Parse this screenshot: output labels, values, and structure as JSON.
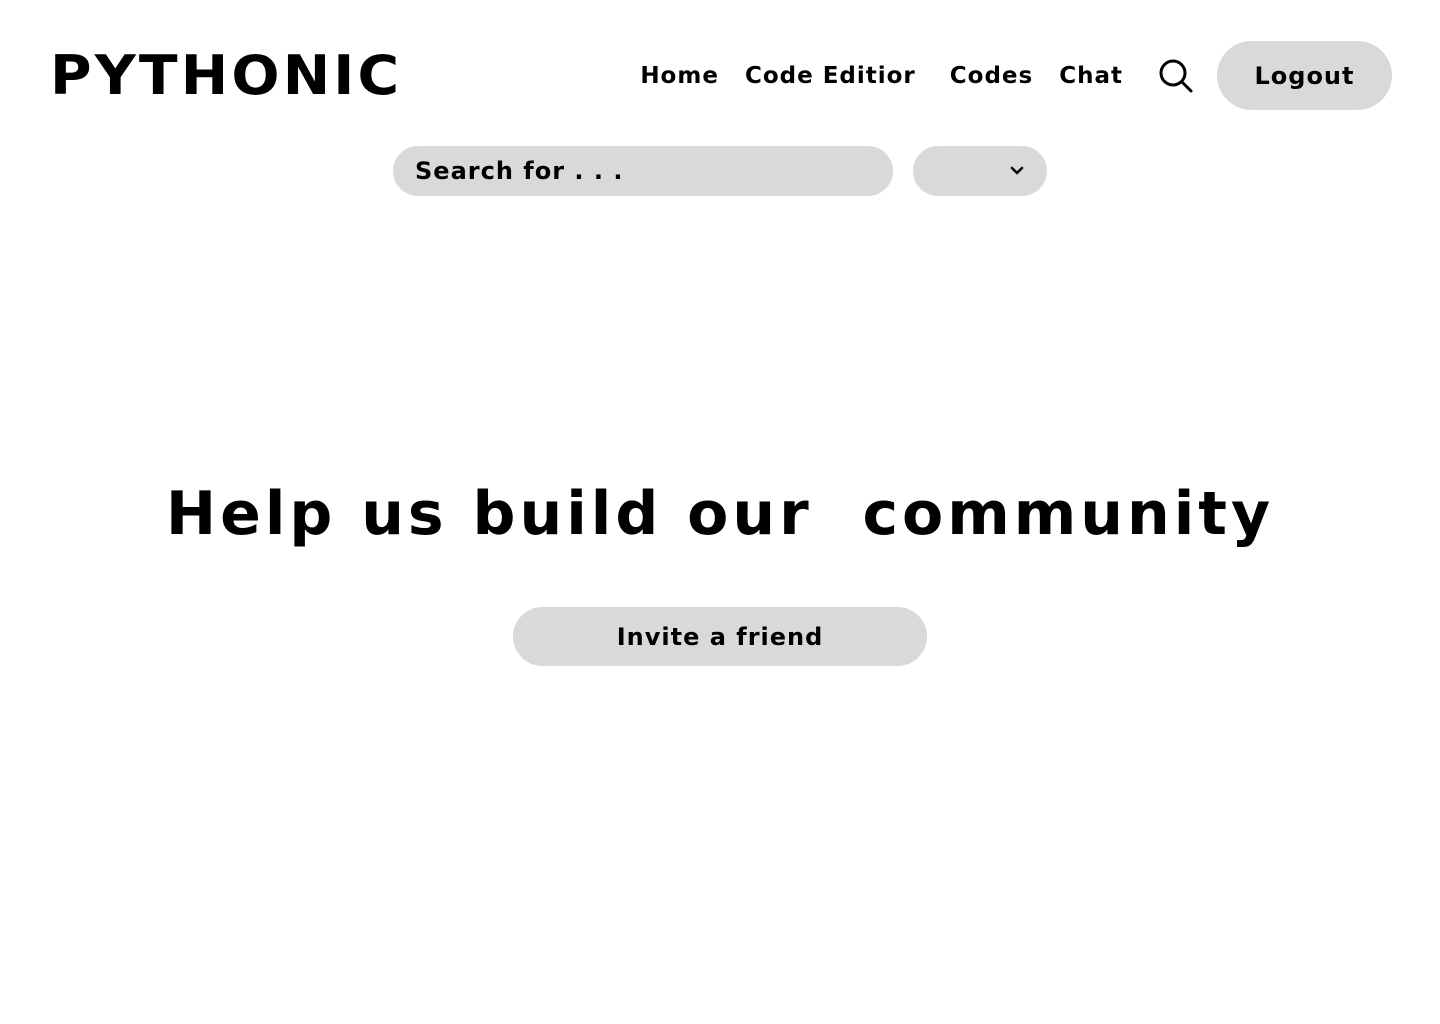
{
  "header": {
    "logo": "PYTHONIC",
    "nav": {
      "home": "Home",
      "code_editor": "Code Editior",
      "codes": "Codes",
      "chat": "Chat"
    },
    "search_icon": "search-icon",
    "logout_label": "Logout"
  },
  "search": {
    "placeholder": "Search for . . .",
    "value": ""
  },
  "filter": {
    "selected": "",
    "icon": "chevron-down-icon"
  },
  "main": {
    "headline": "Help us build our  community",
    "invite_label": "Invite a friend"
  },
  "colors": {
    "background": "#ffffff",
    "control_fill": "#d9d9d9",
    "text": "#000000"
  }
}
